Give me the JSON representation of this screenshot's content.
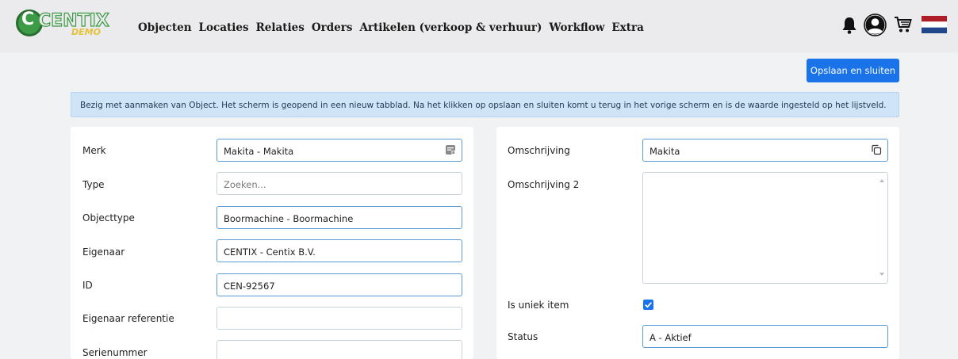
{
  "logo": {
    "brand": "CENTIX",
    "c_letter": "C",
    "demo": "DEMO"
  },
  "nav": {
    "items": [
      "Objecten",
      "Locaties",
      "Relaties",
      "Orders",
      "Artikelen (verkoop & verhuur)",
      "Workflow",
      "Extra"
    ]
  },
  "header_icons": [
    "bell-icon",
    "user-avatar-icon",
    "shopping-cart-icon",
    "netherlands-flag-icon"
  ],
  "actions": {
    "save_close": "Opslaan en sluiten"
  },
  "info_message": "Bezig met aanmaken van Object. Het scherm is geopend in een nieuw tabblad. Na het klikken op opslaan en sluiten komt u terug in het vorige scherm en is de waarde ingesteld op het lijstveld.",
  "left_form": {
    "merk": {
      "label": "Merk",
      "value": "Makita - Makita"
    },
    "type": {
      "label": "Type",
      "placeholder": "Zoeken..."
    },
    "objecttype": {
      "label": "Objecttype",
      "value": "Boormachine - Boormachine"
    },
    "eigenaar": {
      "label": "Eigenaar",
      "value": "CENTIX - Centix B.V."
    },
    "id": {
      "label": "ID",
      "value": "CEN-92567"
    },
    "eigenaar_referentie": {
      "label": "Eigenaar referentie",
      "value": ""
    },
    "serienummer": {
      "label": "Serienummer",
      "value": ""
    }
  },
  "right_form": {
    "omschrijving": {
      "label": "Omschrijving",
      "value": "Makita"
    },
    "omschrijving2": {
      "label": "Omschrijving 2",
      "value": ""
    },
    "is_uniek_item": {
      "label": "Is uniek item",
      "checked": true
    },
    "status": {
      "label": "Status",
      "value": "A - Aktief"
    }
  },
  "colors": {
    "accent": "#1a73e8",
    "info_bg": "#cfe4f6",
    "page_bg": "#f1f2f4",
    "logo_green": "#3d9a46",
    "logo_yellow": "#e3c23a"
  }
}
